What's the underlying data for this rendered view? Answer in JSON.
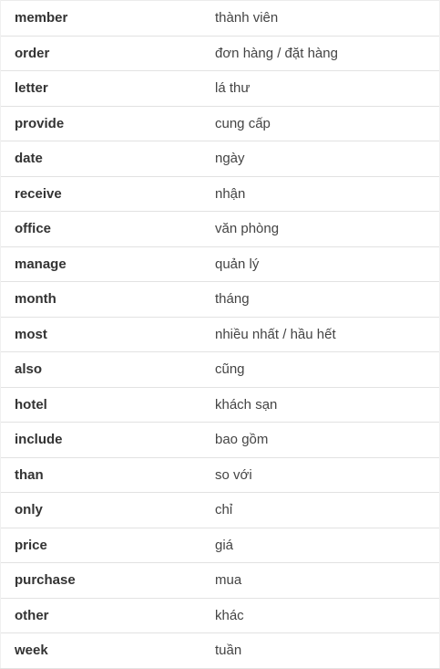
{
  "vocabulary": [
    {
      "word": "member",
      "meaning": "thành viên"
    },
    {
      "word": "order",
      "meaning": "đơn hàng / đặt hàng"
    },
    {
      "word": "letter",
      "meaning": "lá thư"
    },
    {
      "word": "provide",
      "meaning": "cung cấp"
    },
    {
      "word": "date",
      "meaning": "ngày"
    },
    {
      "word": "receive",
      "meaning": "nhận"
    },
    {
      "word": "office",
      "meaning": "văn phòng"
    },
    {
      "word": "manage",
      "meaning": "quản lý"
    },
    {
      "word": "month",
      "meaning": "tháng"
    },
    {
      "word": "most",
      "meaning": "nhiều nhất / hầu hết"
    },
    {
      "word": "also",
      "meaning": "cũng"
    },
    {
      "word": "hotel",
      "meaning": "khách sạn"
    },
    {
      "word": "include",
      "meaning": "bao gồm"
    },
    {
      "word": "than",
      "meaning": "so với"
    },
    {
      "word": "only",
      "meaning": "chỉ"
    },
    {
      "word": "price",
      "meaning": "giá"
    },
    {
      "word": "purchase",
      "meaning": "mua"
    },
    {
      "word": "other",
      "meaning": "khác"
    },
    {
      "word": "week",
      "meaning": "tuần"
    }
  ]
}
